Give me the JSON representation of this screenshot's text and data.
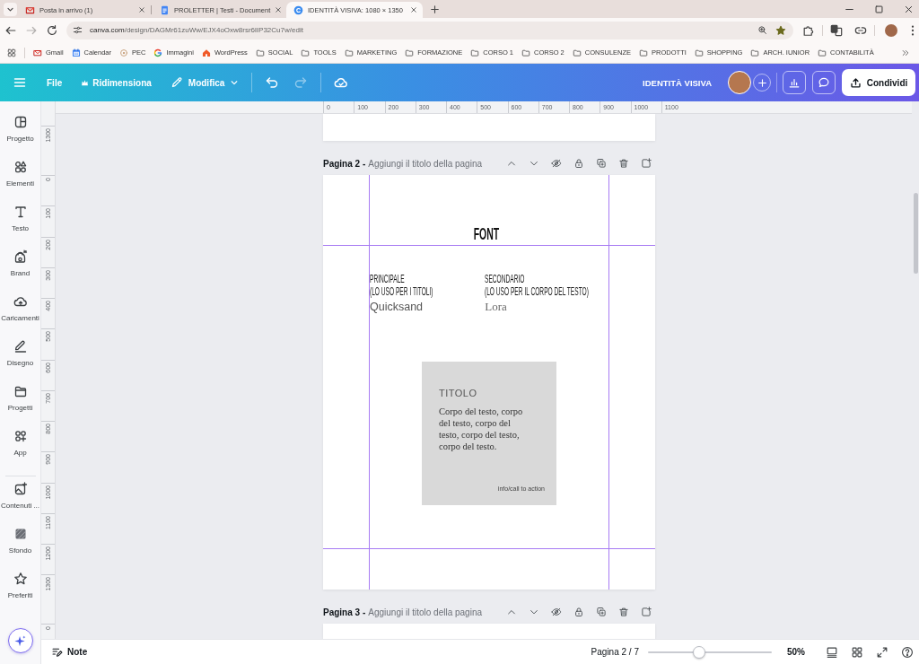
{
  "browser": {
    "tabs": [
      {
        "title": "Posta in arrivo (1)",
        "selected": false
      },
      {
        "title": "PROLETTER | Testi - Document",
        "selected": false
      },
      {
        "title": "IDENTITÀ VISIVA: 1080 × 1350",
        "selected": true
      }
    ],
    "nav_buttons": [
      {
        "disabled": false
      },
      {
        "disabled": true
      }
    ],
    "address": {
      "host": "canva.com",
      "path": "/design/DAGMr61zuWw/EJX4oOxw8rsr6lIP32Cu7w/edit"
    },
    "bookmarks": [
      {
        "label": "Gmail",
        "kind": "site"
      },
      {
        "label": "Calendar",
        "kind": "site"
      },
      {
        "label": "PEC",
        "kind": "site"
      },
      {
        "label": "Immagini",
        "kind": "site"
      },
      {
        "label": "WordPress",
        "kind": "site"
      },
      {
        "label": "SOCIAL",
        "kind": "folder"
      },
      {
        "label": "TOOLS",
        "kind": "folder"
      },
      {
        "label": "MARKETING",
        "kind": "folder"
      },
      {
        "label": "FORMAZIONE",
        "kind": "folder"
      },
      {
        "label": "CORSO 1",
        "kind": "folder"
      },
      {
        "label": "CORSO 2",
        "kind": "folder"
      },
      {
        "label": "CONSULENZE",
        "kind": "folder"
      },
      {
        "label": "PRODOTTI",
        "kind": "folder"
      },
      {
        "label": "SHOPPING",
        "kind": "folder"
      },
      {
        "label": "ARCH. IUNIOR",
        "kind": "folder"
      },
      {
        "label": "CONTABILITÀ",
        "kind": "folder"
      }
    ]
  },
  "editor_toolbar": {
    "menus": [
      "File",
      "Ridimensiona",
      "Modifica"
    ],
    "history": [
      {
        "disabled": false
      },
      {
        "disabled": true
      }
    ],
    "design_title": "IDENTITÀ VISIVA",
    "share_button": "Condividi"
  },
  "sidebar": {
    "items": [
      {
        "label": "Progetto",
        "selected": false
      },
      {
        "label": "Elementi",
        "selected": false
      },
      {
        "label": "Testo",
        "selected": false
      },
      {
        "label": "Brand",
        "selected": false
      },
      {
        "label": "Caricamenti",
        "selected": false
      },
      {
        "label": "Disegno",
        "selected": false
      },
      {
        "label": "Progetti",
        "selected": false
      },
      {
        "label": "App",
        "selected": false
      },
      {
        "label": "Contenuti ...",
        "selected": false
      },
      {
        "label": "Sfondo",
        "selected": false
      },
      {
        "label": "Preferiti",
        "selected": false
      }
    ]
  },
  "rulers": {
    "horizontal": [
      "0",
      "100",
      "200",
      "300",
      "400",
      "500",
      "600",
      "700",
      "800",
      "900",
      "1000",
      "1100"
    ],
    "vertical": [
      {
        "labels": [
          "1300"
        ]
      },
      {
        "labels": [
          "0",
          "100",
          "200",
          "300",
          "400",
          "500",
          "600",
          "700",
          "800",
          "900",
          "1000",
          "1100",
          "1200",
          "1300"
        ]
      },
      {
        "labels": [
          "0"
        ]
      }
    ]
  },
  "pages": [
    {
      "label": "Pagina 2 -",
      "placeholder": "Aggiungi il titolo della pagina",
      "content": {
        "heading": "FONT",
        "fonts": [
          {
            "role": "PRINCIPALE",
            "usage": "(LO USO PER I TITOLI)",
            "name": "Quicksand",
            "kind": "sans"
          },
          {
            "role": "SECONDARIO",
            "usage": "(LO USO PER IL CORPO DEL TESTO)",
            "name": "Lora",
            "kind": "serif"
          }
        ],
        "sample_card": {
          "title": "TITOLO",
          "body": "Corpo del testo, corpo del testo, corpo del testo, corpo del testo, corpo del testo.",
          "footer": "info/call to action"
        }
      }
    },
    {
      "label": "Pagina 3 -",
      "placeholder": "Aggiungi il titolo della pagina"
    }
  ],
  "bottom_bar": {
    "notes_button": "Note",
    "page_indicator": "Pagina 2 / 7",
    "zoom": {
      "level": 0.41,
      "reading": "50%"
    }
  }
}
